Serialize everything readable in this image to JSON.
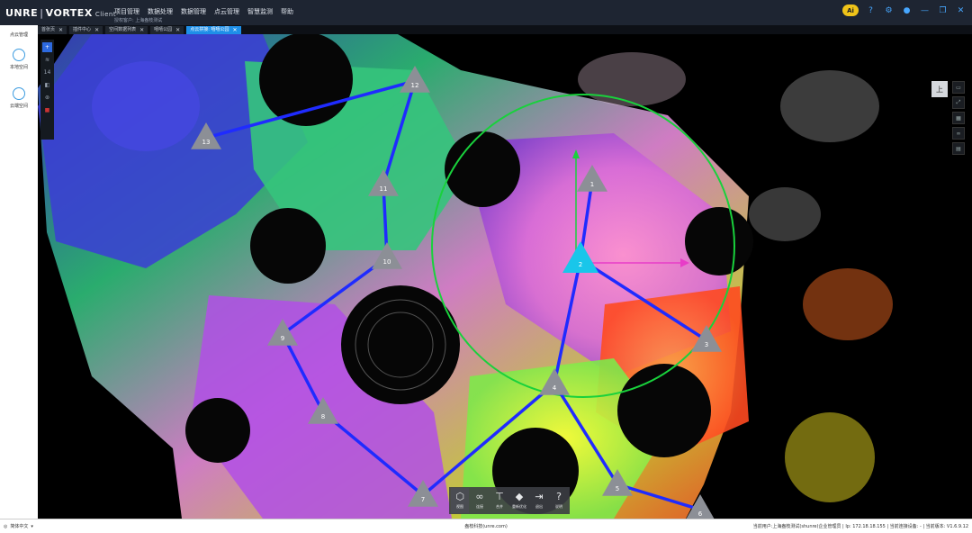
{
  "app": {
    "brand_left": "UNRE",
    "brand_sep": "|",
    "brand_right": "VORTEX",
    "brand_suffix": "Client"
  },
  "menu": [
    "项目管理",
    "数据处理",
    "数据管理",
    "点云管理",
    "智慧监测",
    "帮助"
  ],
  "tenant": "授权客户: 上海盎枝测试",
  "tabs": [
    {
      "label": "首张页"
    },
    {
      "label": "插件中心"
    },
    {
      "label": "空间数据列表"
    },
    {
      "label": "嘻嘻公园"
    },
    {
      "label": "点云拼接: 嘻嘻公园",
      "active": true
    }
  ],
  "window_icons": [
    "ai-badge",
    "help-icon",
    "settings-icon",
    "user-icon",
    "minimize-icon",
    "maximize-icon",
    "close-icon"
  ],
  "sidebar": {
    "title": "点云管理",
    "items": [
      {
        "label": "本地空间",
        "icon": "cube-icon"
      },
      {
        "label": "云端空间",
        "icon": "cloud-icon"
      }
    ]
  },
  "left_panel": {
    "count": "14"
  },
  "view_button": "上",
  "stations": [
    {
      "id": "1"
    },
    {
      "id": "2"
    },
    {
      "id": "3"
    },
    {
      "id": "4"
    },
    {
      "id": "5"
    },
    {
      "id": "6"
    },
    {
      "id": "7"
    },
    {
      "id": "8"
    },
    {
      "id": "9"
    },
    {
      "id": "10"
    },
    {
      "id": "11"
    },
    {
      "id": "12"
    },
    {
      "id": "13"
    }
  ],
  "links": [
    [
      "1",
      "2"
    ],
    [
      "2",
      "3"
    ],
    [
      "2",
      "4"
    ],
    [
      "4",
      "5"
    ],
    [
      "5",
      "6"
    ],
    [
      "4",
      "7"
    ],
    [
      "7",
      "8"
    ],
    [
      "8",
      "9"
    ],
    [
      "9",
      "10"
    ],
    [
      "10",
      "11"
    ],
    [
      "11",
      "12"
    ],
    [
      "12",
      "13"
    ]
  ],
  "toolbar": [
    {
      "label": "视图",
      "icon": "cube-view-icon",
      "active": true
    },
    {
      "label": "连接",
      "icon": "link-icon"
    },
    {
      "label": "合并",
      "icon": "merge-icon"
    },
    {
      "label": "重新优化",
      "icon": "optimize-icon"
    },
    {
      "label": "退出",
      "icon": "exit-icon"
    },
    {
      "label": "说明",
      "icon": "help-icon"
    }
  ],
  "statusbar": {
    "language": "简体中文",
    "copyright": "盎枝科技(unre.com)",
    "right": "当前用户:上海盎枝测试(shunre)企业管理员 | Ip: 172.18.18.155 | 当前连接设备: - | 当前版本: V1.6.9.12"
  },
  "colors": {
    "accent": "#1e8fe8",
    "link": "#1f2bff",
    "station": "#8c8f96",
    "selected_station": "#19c6ea",
    "selection_circle": "#19d13c"
  }
}
